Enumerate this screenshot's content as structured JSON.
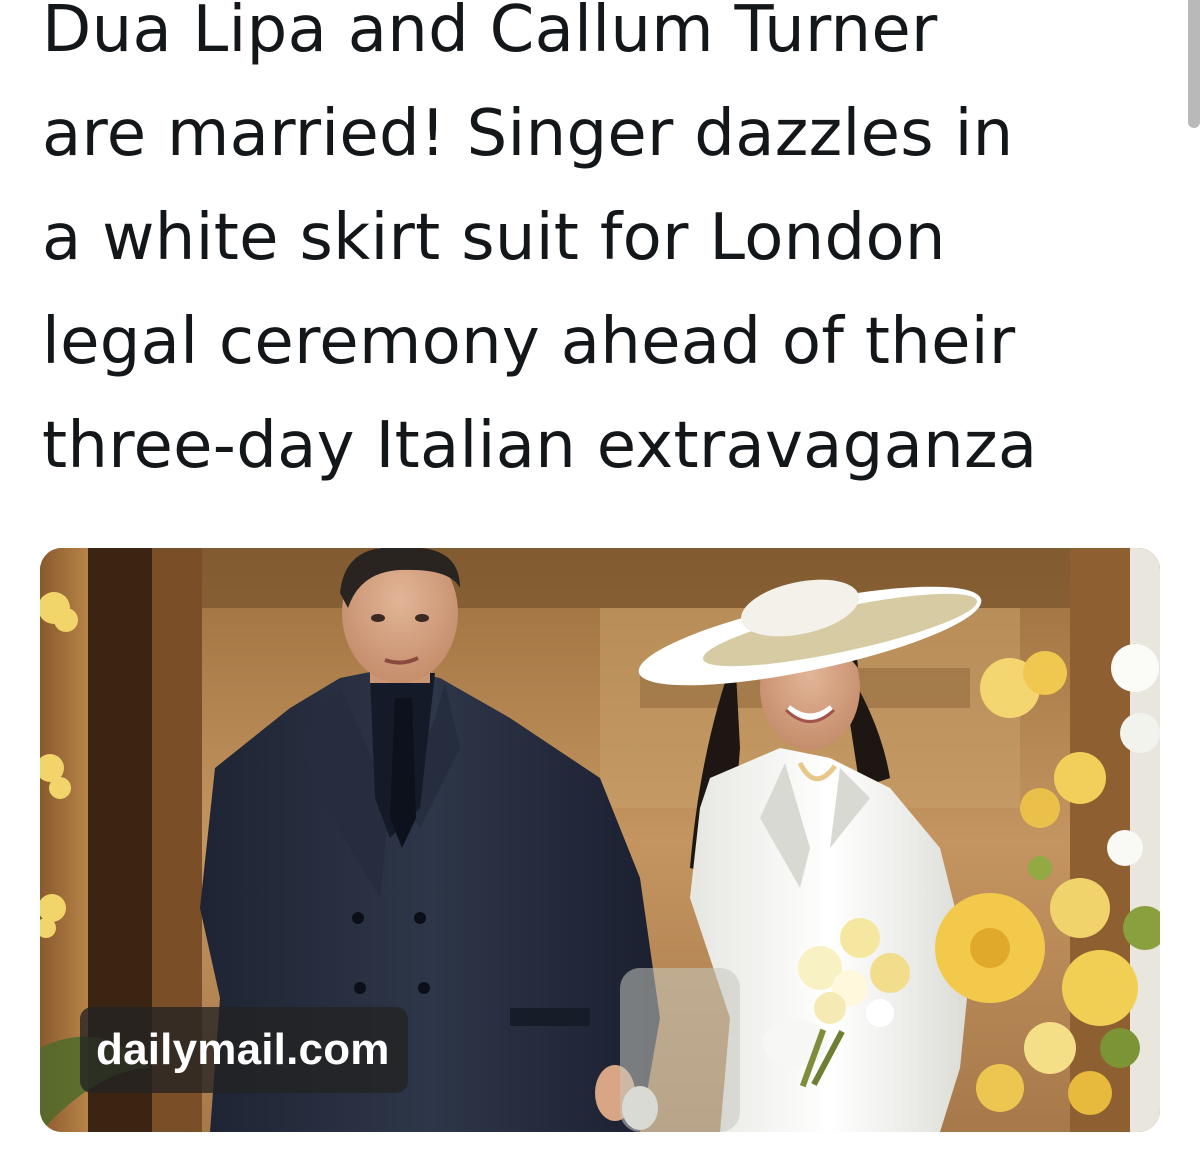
{
  "headline": {
    "lines": [
      "Dua Lipa and Callum Turner",
      "are married! Singer dazzles in",
      "a white skirt suit for London",
      "legal ceremony ahead of their",
      "three-day Italian extravaganza"
    ]
  },
  "card": {
    "source_label": "dailymail.com"
  },
  "colors": {
    "text": "#14171a",
    "badge_background": "#232323",
    "badge_text": "#ffffff"
  }
}
